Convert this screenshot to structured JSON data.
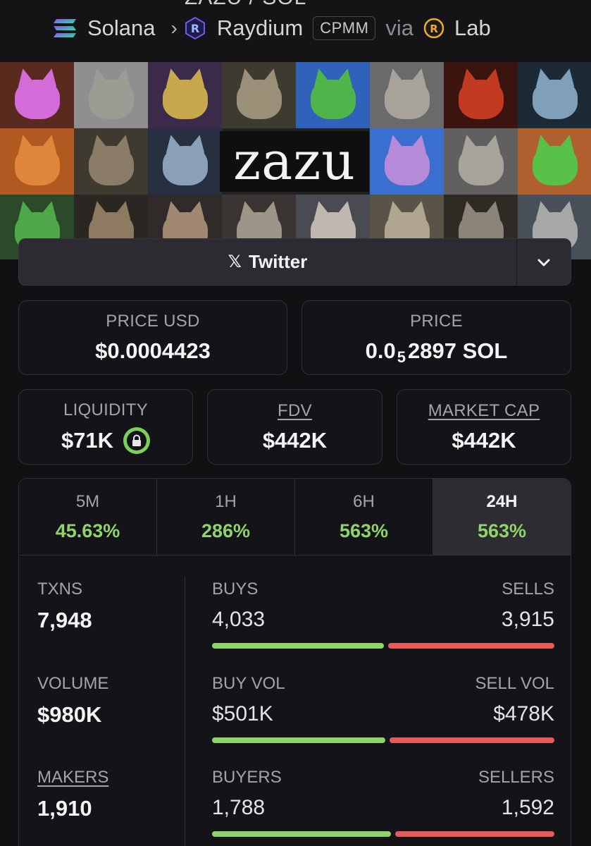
{
  "header": {
    "partial_title": "ZAZU / SOL",
    "chain": "Solana",
    "dex": "Raydium",
    "pool_type": "CPMM",
    "via": "via",
    "launchpad": "Lab"
  },
  "banner": {
    "title": "zazu"
  },
  "social": {
    "label": "Twitter",
    "icon": "x-icon"
  },
  "prices": {
    "price_usd_label": "PRICE USD",
    "price_usd": "$0.0004423",
    "price_label": "PRICE",
    "price_prefix": "0.0",
    "price_zeros": "5",
    "price_suffix": "2897 SOL"
  },
  "metrics": {
    "liquidity_label": "LIQUIDITY",
    "liquidity": "$71K",
    "fdv_label": "FDV",
    "fdv": "$442K",
    "mcap_label": "MARKET CAP",
    "mcap": "$442K"
  },
  "timeframes": [
    {
      "label": "5M",
      "change": "45.63%"
    },
    {
      "label": "1H",
      "change": "286%"
    },
    {
      "label": "6H",
      "change": "563%"
    },
    {
      "label": "24H",
      "change": "563%"
    }
  ],
  "active_timeframe": "24H",
  "txns": {
    "txns_label": "TXNS",
    "txns": "7,948",
    "volume_label": "VOLUME",
    "volume": "$980K",
    "makers_label": "MAKERS",
    "makers": "1,910",
    "buys_label": "BUYS",
    "buys": "4,033",
    "sells_label": "SELLS",
    "sells": "3,915",
    "buy_vol_label": "BUY VOL",
    "buy_vol": "$501K",
    "sell_vol_label": "SELL VOL",
    "sell_vol": "$478K",
    "buyers_label": "BUYERS",
    "buyers": "1,788",
    "sellers_label": "SELLERS",
    "sellers": "1,592"
  },
  "colors": {
    "positive": "#8fd46a",
    "negative": "#e85a5a",
    "background": "#111114"
  }
}
